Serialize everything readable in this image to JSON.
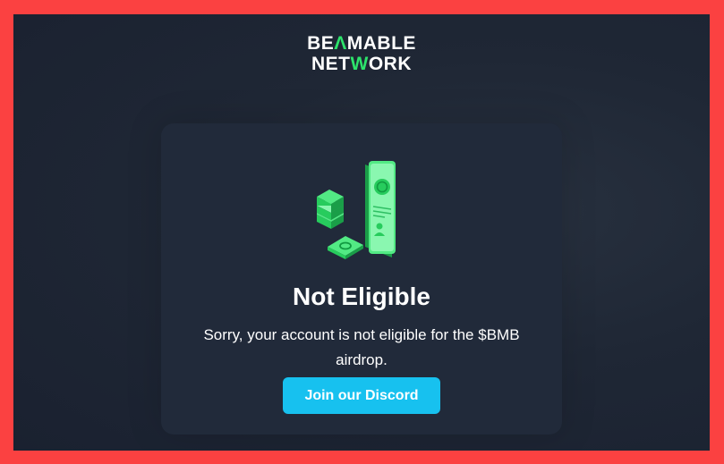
{
  "brand": {
    "logo_line1_a": "BE",
    "logo_line1_b": "Λ",
    "logo_line1_c": "MABLE",
    "logo_line2_a": "NET",
    "logo_line2_b": "W",
    "logo_line2_c": "ORK",
    "accent_color": "#2de36b"
  },
  "card": {
    "illustration_icon": "phone-and-cash-icon",
    "title": "Not Eligible",
    "message": "Sorry, your account is not eligible for the $BMB airdrop.",
    "cta_label": "Join our Discord",
    "cta_color": "#17c1ef"
  }
}
